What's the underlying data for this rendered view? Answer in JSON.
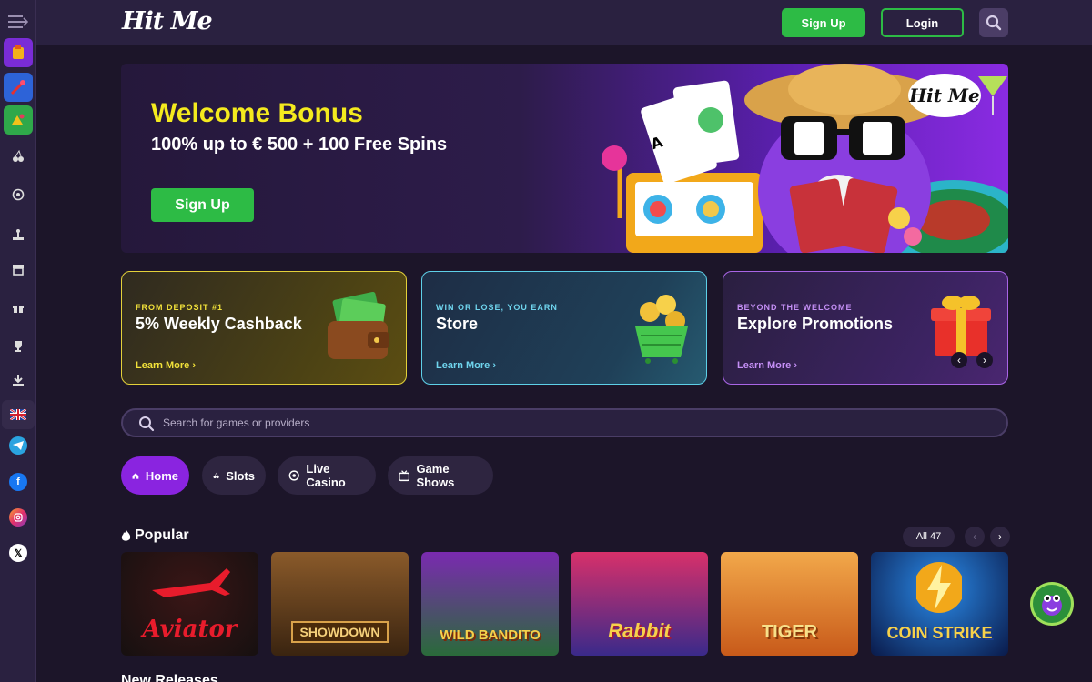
{
  "header": {
    "logo_text": "Hit Me",
    "signup_label": "Sign Up",
    "login_label": "Login"
  },
  "sidebar": {
    "icons": [
      "menu-icon",
      "tile-one-icon",
      "tile-two-icon",
      "tile-three-icon",
      "cherries-icon",
      "roulette-icon",
      "joystick-icon",
      "store-icon",
      "gift-icon",
      "trophy-icon",
      "download-icon",
      "uk-flag-icon",
      "telegram-icon",
      "facebook-icon",
      "instagram-icon",
      "x-icon"
    ]
  },
  "hero": {
    "title": "Welcome Bonus",
    "subtitle": "100% up to € 500 + 100 Free Spins",
    "cta_label": "Sign Up",
    "art_logo": "Hit Me"
  },
  "promos": [
    {
      "eyebrow": "FROM DEPOSIT #1",
      "title": "5% Weekly Cashback",
      "link": "Learn More ›"
    },
    {
      "eyebrow": "WIN OR LOSE, YOU EARN",
      "title": "Store",
      "link": "Learn More ›"
    },
    {
      "eyebrow": "BEYOND THE WELCOME",
      "title": "Explore Promotions",
      "link": "Learn More ›"
    }
  ],
  "search": {
    "placeholder": "Search for games or providers"
  },
  "tabs": [
    {
      "label": "Home",
      "active": true
    },
    {
      "label": "Slots",
      "active": false
    },
    {
      "label": "Live Casino",
      "active": false
    },
    {
      "label": "Game Shows",
      "active": false
    }
  ],
  "popular": {
    "title": "Popular",
    "all_label": "All",
    "count": "47",
    "games": [
      {
        "name": "Aviator"
      },
      {
        "name": "SHOWDOWN"
      },
      {
        "name": "WILD BANDITO"
      },
      {
        "name": "Rabbit"
      },
      {
        "name": "TIGER"
      },
      {
        "name": "COIN STRIKE"
      }
    ]
  },
  "next_section": {
    "title": "New Releases"
  },
  "colors": {
    "background": "#1c1529",
    "panel": "#2a2140",
    "accent_green": "#2dbb45",
    "accent_purple": "#8a24e0",
    "hero_title_yellow": "#f4ea1e"
  }
}
